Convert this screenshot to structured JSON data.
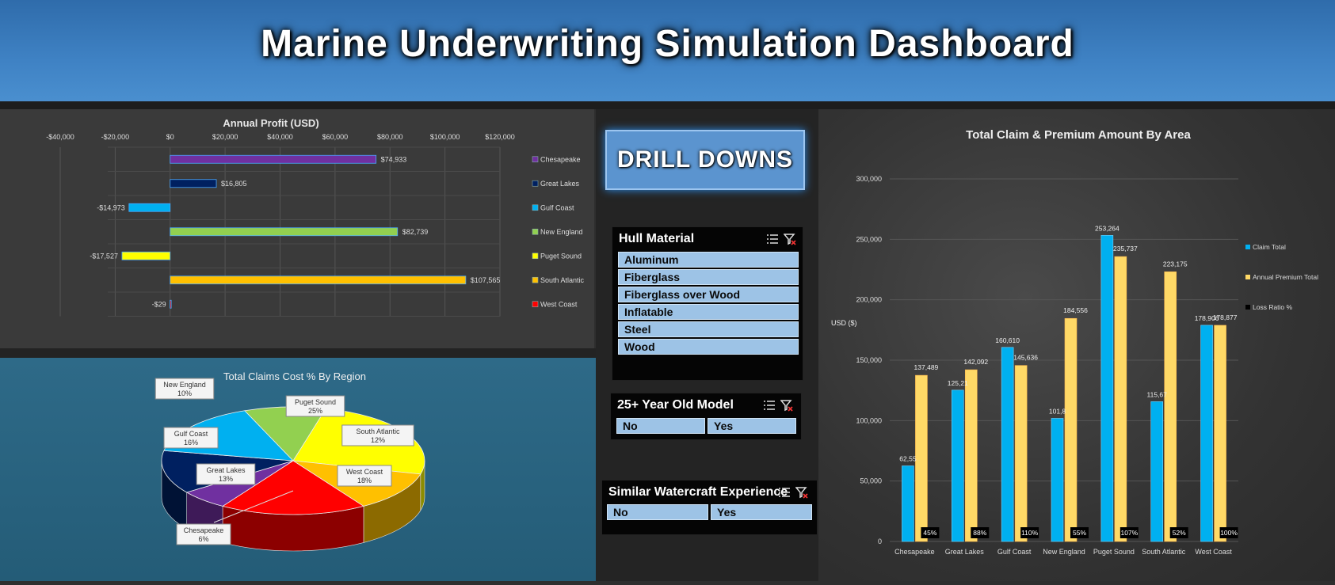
{
  "header": {
    "title": "Marine Underwriting Simulation Dashboard"
  },
  "drill_button": {
    "label": "DRILL DOWNS"
  },
  "slicers": {
    "hull": {
      "title": "Hull Material",
      "items": [
        "Aluminum",
        "Fiberglass",
        "Fiberglass over Wood",
        "Inflatable",
        "Steel",
        "Wood"
      ]
    },
    "old_model": {
      "title": "25+ Year Old Model",
      "items": [
        "No",
        "Yes"
      ]
    },
    "experience": {
      "title": "Similar Watercraft Experience",
      "items": [
        "No",
        "Yes"
      ]
    },
    "icons": [
      "multi-select-icon",
      "clear-filter-icon"
    ]
  },
  "chart_data": [
    {
      "type": "bar",
      "orientation": "horizontal",
      "title": "Annual Profit (USD)",
      "categories": [
        "Chesapeake",
        "Great Lakes",
        "Gulf Coast",
        "New England",
        "Puget Sound",
        "South Atlantic",
        "West Coast"
      ],
      "values": [
        74933,
        16805,
        -14973,
        82739,
        -17527,
        107565,
        -29
      ],
      "data_labels": [
        "$74,933",
        "$16,805",
        "-$14,973",
        "$82,739",
        "-$17,527",
        "$107,565",
        "-$29"
      ],
      "colors": [
        "#7030a0",
        "#002060",
        "#00b0f0",
        "#92d050",
        "#ffff00",
        "#ffc000",
        "#ff0000"
      ],
      "xlim": [
        -40000,
        120000
      ],
      "xticks": [
        "-$40,000",
        "-$20,000",
        "$0",
        "$20,000",
        "$40,000",
        "$60,000",
        "$80,000",
        "$100,000",
        "$120,000"
      ],
      "legend": "right",
      "grid": true
    },
    {
      "type": "pie",
      "title": "Total Claims Cost % By Region",
      "slices": [
        {
          "name": "Puget Sound",
          "value": 25,
          "color": "#ffff00"
        },
        {
          "name": "South Atlantic",
          "value": 12,
          "color": "#ffc000"
        },
        {
          "name": "West Coast",
          "value": 18,
          "color": "#ff0000"
        },
        {
          "name": "Chesapeake",
          "value": 6,
          "color": "#7030a0"
        },
        {
          "name": "Great Lakes",
          "value": 13,
          "color": "#002060"
        },
        {
          "name": "Gulf Coast",
          "value": 16,
          "color": "#00b0f0"
        },
        {
          "name": "New England",
          "value": 10,
          "color": "#92d050"
        }
      ],
      "labels": [
        "Puget Sound\n25%",
        "South Atlantic\n12%",
        "West Coast\n18%",
        "Chesapeake\n6%",
        "Great Lakes\n13%",
        "Gulf Coast\n16%",
        "New England\n10%"
      ]
    },
    {
      "type": "bar",
      "title": "Total Claim & Premium Amount By Area",
      "ylabel": "USD ($)",
      "categories": [
        "Chesapeake",
        "Great Lakes",
        "Gulf Coast",
        "New England",
        "Puget Sound",
        "South Atlantic",
        "West Coast"
      ],
      "series": [
        {
          "name": "Claim Total",
          "color": "#00b0f0",
          "values": [
            62555,
            125215,
            160610,
            101875,
            253264,
            115675,
            178906
          ],
          "labels": [
            "62,55",
            "125,21",
            "160,610",
            "101,8",
            "253,264",
            "115,67",
            "178,906"
          ]
        },
        {
          "name": "Annual Premium Total",
          "color": "#ffd966",
          "values": [
            137489,
            142092,
            145636,
            184556,
            235737,
            223175,
            178877
          ],
          "labels": [
            "137,489",
            "142,092",
            "145,636",
            "184,556",
            "235,737",
            "223,175",
            "178,877"
          ]
        },
        {
          "name": "Loss Ratio %",
          "color": "#000000",
          "labels": [
            "45%",
            "88%",
            "110%",
            "55%",
            "107%",
            "52%",
            "100%"
          ]
        }
      ],
      "ylim": [
        0,
        300000
      ],
      "yticks": [
        "0",
        "50,000",
        "100,000",
        "150,000",
        "200,000",
        "250,000",
        "300,000"
      ],
      "legend": "right",
      "grid": true
    }
  ]
}
